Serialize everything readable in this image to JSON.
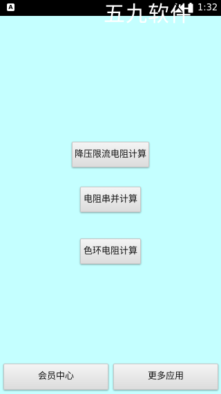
{
  "status_bar": {
    "notification_icon_letter": "A",
    "watermark": "五九软件",
    "time": "1:32",
    "icons": [
      "notification-a-icon",
      "signal-icon",
      "battery-icon"
    ]
  },
  "main": {
    "buttons": [
      {
        "label": "降压限流电阻计算"
      },
      {
        "label": "电阻串并计算"
      },
      {
        "label": "色环电阻计算"
      }
    ]
  },
  "bottom_bar": {
    "member_label": "会员中心",
    "more_label": "更多应用"
  },
  "colors": {
    "background": "#c4ffff",
    "status_bar": "#000000",
    "button": "#e8e8e8"
  }
}
